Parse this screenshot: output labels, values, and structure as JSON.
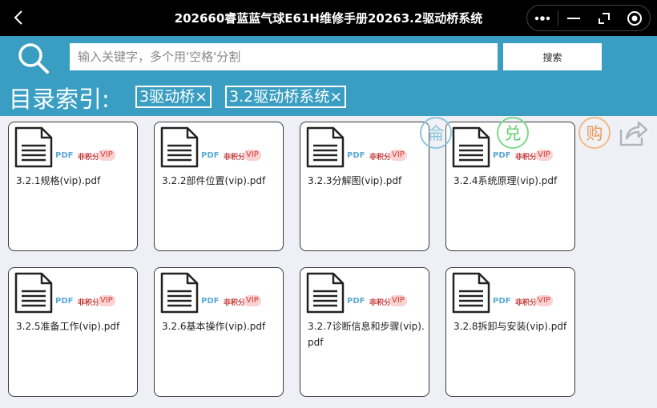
{
  "window": {
    "title": "202660睿蓝蓝气球E61H维修手册20263.2驱动桥系统"
  },
  "search": {
    "placeholder": "输入关键字，多个用'空格'分割",
    "button_label": "搜索"
  },
  "index": {
    "label": "目录索引:",
    "chips": [
      "3驱动桥×",
      "3.2驱动桥系统×"
    ]
  },
  "file_tags": {
    "pdf": "PDF",
    "points": "非积分",
    "vip": "VIP"
  },
  "files": [
    {
      "name": "3.2.1规格(vip).pdf"
    },
    {
      "name": "3.2.2部件位置(vip).pdf"
    },
    {
      "name": "3.2.3分解图(vip).pdf"
    },
    {
      "name": "3.2.4系统原理(vip).pdf"
    },
    {
      "name": "3.2.5准备工作(vip).pdf"
    },
    {
      "name": "3.2.6基本操作(vip).pdf"
    },
    {
      "name": "3.2.7诊断信息和步骤(vip).pdf"
    },
    {
      "name": "3.2.8拆卸与安装(vip).pdf"
    }
  ],
  "float_buttons": {
    "pointer": "侖",
    "exchange": "兑",
    "buy": "购"
  },
  "icons": [
    "back-arrow-icon",
    "more-dots-icon",
    "minimize-icon",
    "restore-icon",
    "close-circle-icon",
    "search-icon",
    "document-icon",
    "share-icon"
  ]
}
